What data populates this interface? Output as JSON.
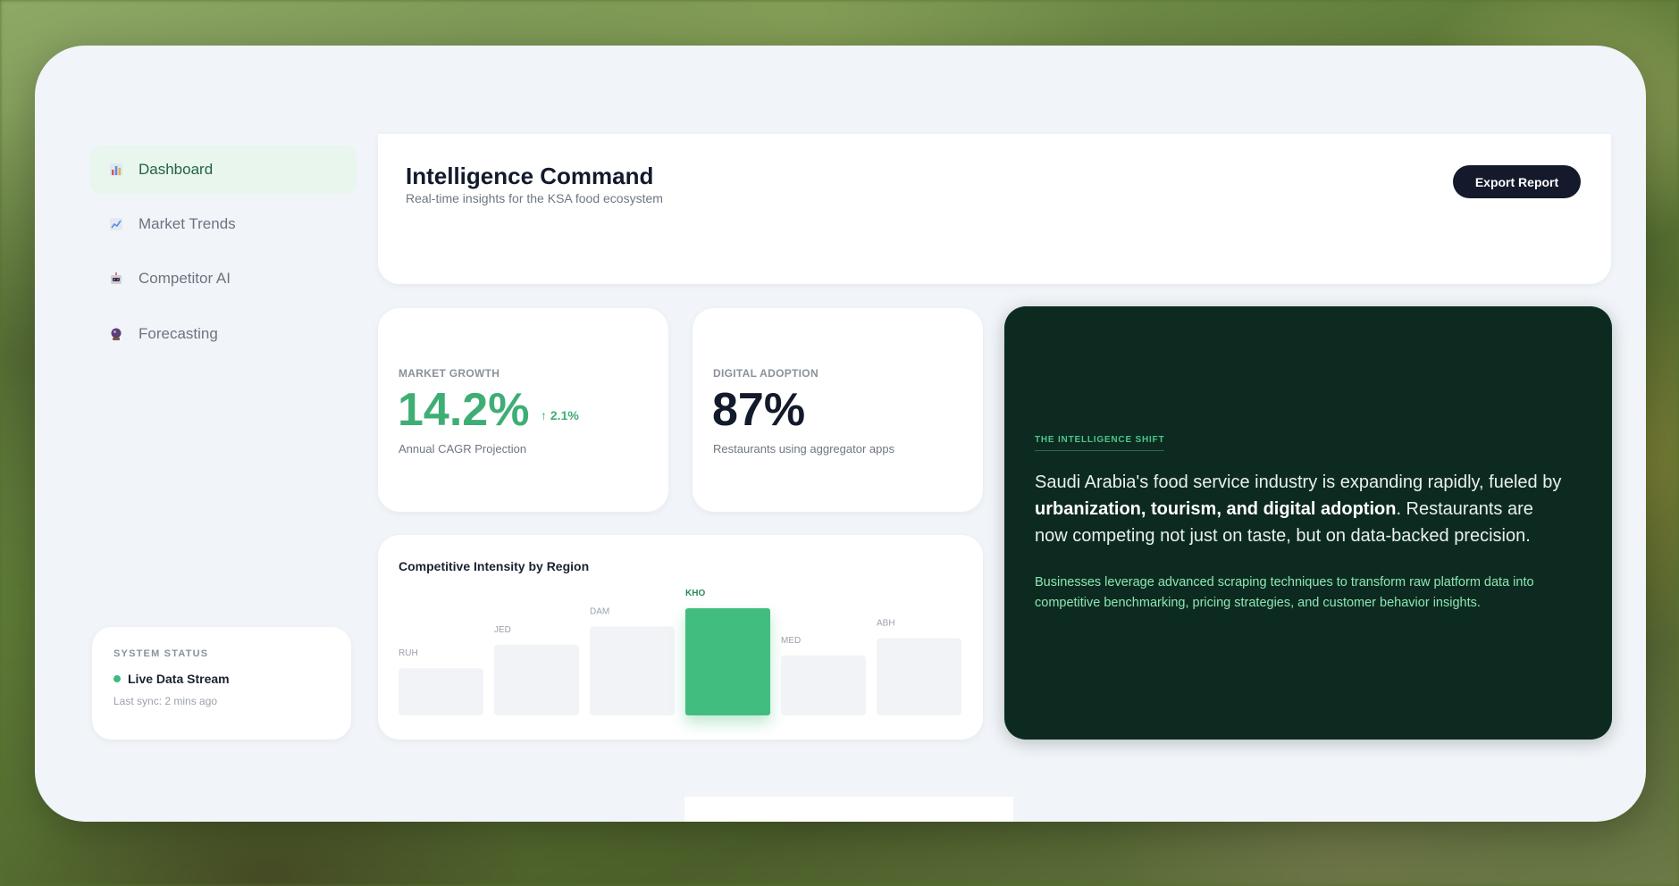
{
  "sidebar": {
    "items": [
      {
        "label": "Dashboard",
        "icon": "bar-chart-icon",
        "active": true
      },
      {
        "label": "Market Trends",
        "icon": "trend-chart-icon",
        "active": false
      },
      {
        "label": "Competitor AI",
        "icon": "robot-icon",
        "active": false
      },
      {
        "label": "Forecasting",
        "icon": "crystal-ball-icon",
        "active": false
      }
    ],
    "status": {
      "title": "SYSTEM STATUS",
      "label": "Live Data Stream",
      "sync": "Last sync: 2 mins ago"
    }
  },
  "header": {
    "title": "Intelligence Command",
    "subtitle": "Real-time insights for the KSA food ecosystem",
    "export_label": "Export Report"
  },
  "metrics": {
    "growth": {
      "label": "MARKET GROWTH",
      "value": "14.2%",
      "change": "↑ 2.1%",
      "sub": "Annual CAGR Projection"
    },
    "adoption": {
      "label": "DIGITAL ADOPTION",
      "value": "87%",
      "sub": "Restaurants using aggregator apps"
    }
  },
  "chart_data": {
    "type": "bar",
    "title": "Competitive Intensity by Region",
    "categories": [
      "RUH",
      "JED",
      "DAM",
      "KHO",
      "MED",
      "ABH"
    ],
    "values": [
      44,
      66,
      83,
      100,
      56,
      72
    ],
    "highlight": "KHO",
    "colors": {
      "bar": "#f1f3f6",
      "highlight": "#43bd80",
      "highlight_label": "#2c8a5b",
      "label": "#9aa1ab"
    }
  },
  "insight": {
    "kicker": "THE INTELLIGENCE SHIFT",
    "text_1": "Saudi Arabia's food service industry is expanding rapidly, fueled by ",
    "text_bold": "urbanization, tourism, and digital adoption",
    "text_2": ". Restaurants are now competing not just on taste, but on data-backed precision.",
    "note": "Businesses leverage advanced scraping techniques to transform raw platform data into competitive benchmarking, pricing strategies, and customer behavior insights."
  },
  "colors": {
    "accent": "#3fae74",
    "dark": "#0d2a20",
    "button": "#141a2b"
  }
}
